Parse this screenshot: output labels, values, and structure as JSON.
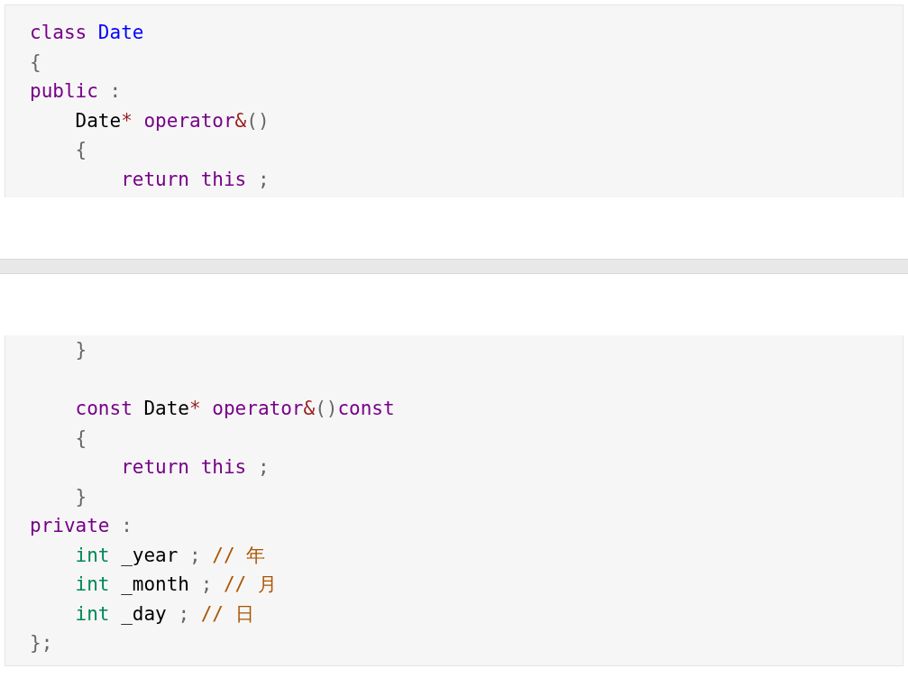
{
  "code_blocks": [
    {
      "cut_off_top": false,
      "cut_off_bottom": true,
      "lines": [
        {
          "kind": "code",
          "tokens": [
            {
              "text": "class ",
              "kind": "keyword"
            },
            {
              "text": "Date",
              "kind": "def"
            }
          ]
        },
        {
          "kind": "code",
          "tokens": [
            {
              "text": "{",
              "kind": "punct"
            }
          ]
        },
        {
          "kind": "code",
          "tokens": [
            {
              "text": "public ",
              "kind": "keyword"
            },
            {
              "text": ":",
              "kind": "punct"
            }
          ]
        },
        {
          "kind": "code",
          "tokens": [
            {
              "text": "    Date",
              "kind": "plain"
            },
            {
              "text": "* ",
              "kind": "op"
            },
            {
              "text": "operator",
              "kind": "keyword"
            },
            {
              "text": "&",
              "kind": "op"
            },
            {
              "text": "()",
              "kind": "punct"
            }
          ]
        },
        {
          "kind": "code",
          "tokens": [
            {
              "text": "    {",
              "kind": "punct"
            }
          ]
        },
        {
          "kind": "code",
          "tokens": [
            {
              "text": "        return this ",
              "kind": "keyword"
            },
            {
              "text": ";",
              "kind": "punct"
            }
          ]
        }
      ]
    },
    {
      "cut_off_top": true,
      "cut_off_bottom": false,
      "lines": [
        {
          "kind": "code",
          "tokens": [
            {
              "text": "    }",
              "kind": "punct"
            }
          ]
        },
        {
          "kind": "blank"
        },
        {
          "kind": "code",
          "tokens": [
            {
              "text": "    const ",
              "kind": "keyword"
            },
            {
              "text": "Date",
              "kind": "plain"
            },
            {
              "text": "* ",
              "kind": "op"
            },
            {
              "text": "operator",
              "kind": "keyword"
            },
            {
              "text": "&",
              "kind": "op"
            },
            {
              "text": "()",
              "kind": "punct"
            },
            {
              "text": "const",
              "kind": "keyword"
            }
          ]
        },
        {
          "kind": "code",
          "tokens": [
            {
              "text": "    {",
              "kind": "punct"
            }
          ]
        },
        {
          "kind": "code",
          "tokens": [
            {
              "text": "        return this ",
              "kind": "keyword"
            },
            {
              "text": ";",
              "kind": "punct"
            }
          ]
        },
        {
          "kind": "code",
          "tokens": [
            {
              "text": "    }",
              "kind": "punct"
            }
          ]
        },
        {
          "kind": "code",
          "tokens": [
            {
              "text": "private ",
              "kind": "keyword"
            },
            {
              "text": ":",
              "kind": "punct"
            }
          ]
        },
        {
          "kind": "code",
          "tokens": [
            {
              "text": "    int",
              "kind": "type"
            },
            {
              "text": " _year ",
              "kind": "plain"
            },
            {
              "text": "; ",
              "kind": "punct"
            },
            {
              "text": "// 年",
              "kind": "comment"
            }
          ]
        },
        {
          "kind": "code",
          "tokens": [
            {
              "text": "    int",
              "kind": "type"
            },
            {
              "text": " _month ",
              "kind": "plain"
            },
            {
              "text": "; ",
              "kind": "punct"
            },
            {
              "text": "// 月",
              "kind": "comment"
            }
          ]
        },
        {
          "kind": "code",
          "tokens": [
            {
              "text": "    int",
              "kind": "type"
            },
            {
              "text": " _day ",
              "kind": "plain"
            },
            {
              "text": "; ",
              "kind": "punct"
            },
            {
              "text": "// 日",
              "kind": "comment"
            }
          ]
        },
        {
          "kind": "code",
          "tokens": [
            {
              "text": "};",
              "kind": "punct"
            }
          ]
        }
      ]
    }
  ]
}
